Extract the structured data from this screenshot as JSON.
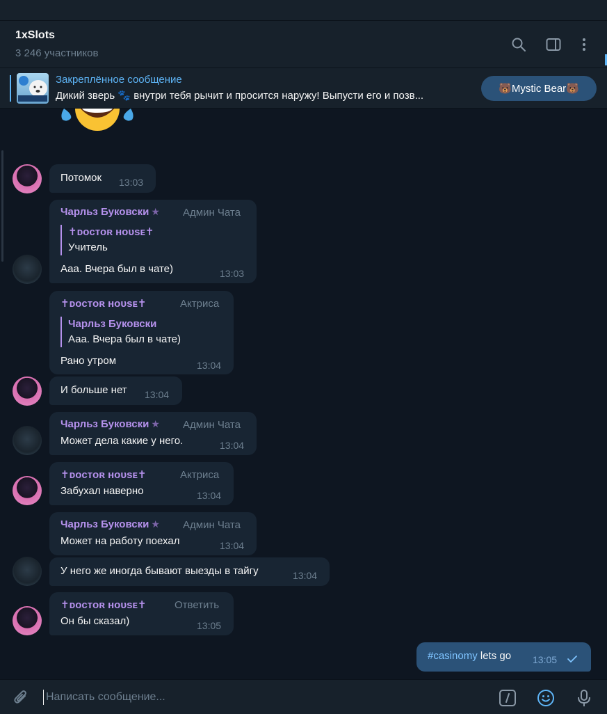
{
  "header": {
    "title": "1xSlots",
    "subtitle": "3 246 участников"
  },
  "pinned": {
    "title": "Закреплённое сообщение",
    "text": "Дикий зверь 🐾 внутри тебя рычит и просится наружу! Выпусти его и позв...",
    "button": "🐻Mystic Bear🐻"
  },
  "messages": [
    {
      "text": "Потомок",
      "time": "13:03"
    },
    {
      "sender": "Чарльз Буковски",
      "role": "Админ Чата",
      "reply_name": "✝︎ᴅᴏᴄᴛᴏʀ ʜᴏᴜsᴇ✝︎",
      "reply_text": "Учитель",
      "text": "Ааа. Вчера был в чате)",
      "time": "13:03"
    },
    {
      "sender": "✝︎ᴅᴏᴄᴛᴏʀ ʜᴏᴜsᴇ✝︎",
      "role": "Актриса",
      "reply_name": "Чарльз Буковски",
      "reply_text": "Ааа. Вчера был в чате)",
      "text": "Рано утром",
      "time": "13:04"
    },
    {
      "text": "И больше нет",
      "time": "13:04"
    },
    {
      "sender": "Чарльз Буковски",
      "role": "Админ Чата",
      "text": "Может дела какие у него.",
      "time": "13:04"
    },
    {
      "sender": "✝︎ᴅᴏᴄᴛᴏʀ ʜᴏᴜsᴇ✝︎",
      "role": "Актриса",
      "text": "Забухал наверно",
      "time": "13:04"
    },
    {
      "sender": "Чарльз Буковски",
      "role": "Админ Чата",
      "text": "Может на работу поехал",
      "time": "13:04"
    },
    {
      "text": "У него же иногда бывают выезды в тайгу",
      "time": "13:04"
    },
    {
      "sender": "✝︎ᴅᴏᴄᴛᴏʀ ʜᴏᴜsᴇ✝︎",
      "role": "Ответить",
      "text": "Он бы сказал)",
      "time": "13:05"
    }
  ],
  "outgoing": {
    "hashtag": "#casinomy",
    "text": " lets go",
    "time": "13:05"
  },
  "input": {
    "placeholder": "Написать сообщение..."
  },
  "colors": {
    "background": "#0e1621",
    "panel": "#17212b",
    "incoming_bubble": "#182533",
    "outgoing_bubble": "#2b5278",
    "accent": "#5eb5f7",
    "sender_name": "#b591ec",
    "muted": "#6d7f8f"
  },
  "icons": [
    "search-icon",
    "sidebar-toggle-icon",
    "more-vertical-icon",
    "attach-icon",
    "commands-icon",
    "emoji-icon",
    "microphone-icon",
    "check-icon",
    "star-icon"
  ]
}
